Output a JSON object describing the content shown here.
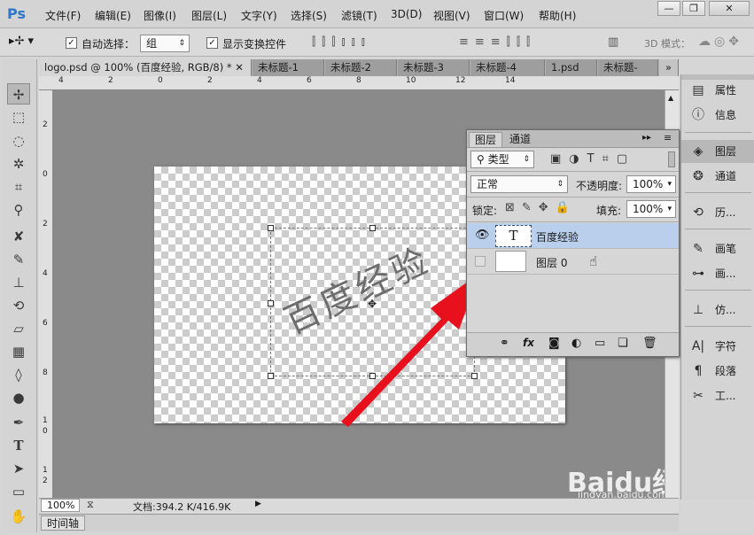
{
  "app": {
    "logo": "Ps"
  },
  "menu": [
    "文件(F)",
    "编辑(E)",
    "图像(I)",
    "图层(L)",
    "文字(Y)",
    "选择(S)",
    "滤镜(T)",
    "3D(D)",
    "视图(V)",
    "窗口(W)",
    "帮助(H)"
  ],
  "window_buttons": {
    "minimize": "—",
    "restore": "❐",
    "close": "✕"
  },
  "options": {
    "auto_select_label": "自动选择：",
    "auto_select_checked": true,
    "auto_select_target": "组",
    "show_transform_label": "显示变换控件",
    "show_transform_checked": true,
    "mode_3d_label": "3D 模式："
  },
  "tabs": [
    "logo.psd @ 100% (百度经验, RGB/8) *",
    "未标题-1",
    "未标题-2",
    "未标题-3",
    "未标题-4",
    "1.psd",
    "未标题-"
  ],
  "ruler_top": [
    "4",
    "2",
    "0",
    "2",
    "4",
    "6",
    "8",
    "10",
    "12",
    "14"
  ],
  "ruler_left": [
    "2",
    "0",
    "2",
    "4",
    "6",
    "8",
    "1",
    "0",
    "1",
    "2"
  ],
  "canvas_text": "百度经验",
  "layers_panel": {
    "tabs": [
      "图层",
      "通道"
    ],
    "filter_kind": "类型",
    "blend_mode": "正常",
    "opacity_label": "不透明度:",
    "opacity": "100%",
    "lock_label": "锁定:",
    "fill_label": "填充:",
    "fill": "100%",
    "layers": [
      {
        "name": "百度经验",
        "type": "text",
        "thumb": "T",
        "visible": true,
        "selected": true
      },
      {
        "name": "图层 0",
        "type": "pixel",
        "visible": false,
        "selected": false
      }
    ],
    "footer_fx": "fx"
  },
  "dock": {
    "groups": [
      [
        {
          "icon": "properties-icon",
          "label": "属性"
        },
        {
          "icon": "info-icon",
          "label": "信息"
        }
      ],
      [
        {
          "icon": "layers-icon",
          "label": "图层"
        },
        {
          "icon": "channels-icon",
          "label": "通道"
        }
      ],
      [
        {
          "icon": "history-icon",
          "label": "历..."
        }
      ],
      [
        {
          "icon": "brush-icon",
          "label": "画笔"
        },
        {
          "icon": "brush-presets-icon",
          "label": "画..."
        }
      ],
      [
        {
          "icon": "clone-source-icon",
          "label": "仿..."
        }
      ],
      [
        {
          "icon": "character-icon",
          "label": "字符"
        },
        {
          "icon": "paragraph-icon",
          "label": "段落"
        },
        {
          "icon": "tool-presets-icon",
          "label": "工..."
        }
      ]
    ]
  },
  "status": {
    "zoom": "100%",
    "doc_info": "文档:394.2 K/416.9K"
  },
  "timeline": {
    "label": "时间轴"
  },
  "watermark": {
    "brand": "Baidu经验",
    "url": "jingyan.baidu.com"
  },
  "colors": {
    "accent_red": "#e8101c",
    "layer_selected": "#b9cfec",
    "ps_blue": "#2e76c8"
  }
}
